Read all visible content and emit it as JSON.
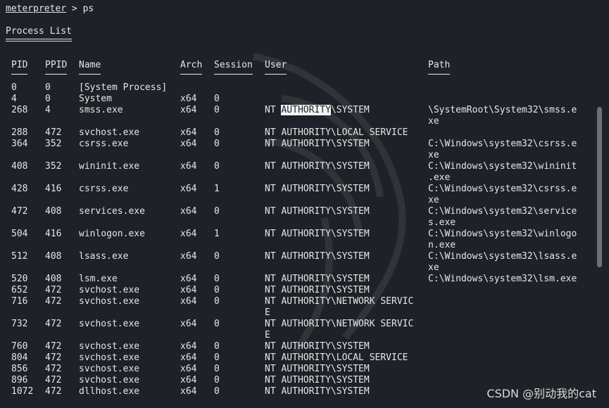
{
  "prompt": {
    "name": "meterpreter",
    "separator": " > ",
    "command": "ps"
  },
  "title": "Process List",
  "headers": [
    "PID",
    "PPID",
    "Name",
    "Arch",
    "Session",
    "User",
    "Path"
  ],
  "rows": [
    {
      "pid": "0",
      "ppid": "0",
      "name": "[System Process]",
      "arch": "",
      "session": "",
      "user": "",
      "path": ""
    },
    {
      "pid": "4",
      "ppid": "0",
      "name": "System",
      "arch": "x64",
      "session": "0",
      "user": "",
      "path": ""
    },
    {
      "pid": "268",
      "ppid": "4",
      "name": "smss.exe",
      "arch": "x64",
      "session": "0",
      "user": "NT AUTHORITY\\SYSTEM",
      "path": "\\SystemRoot\\System32\\smss.exe"
    },
    {
      "pid": "288",
      "ppid": "472",
      "name": "svchost.exe",
      "arch": "x64",
      "session": "0",
      "user": "NT AUTHORITY\\LOCAL SERVICE",
      "path": ""
    },
    {
      "pid": "364",
      "ppid": "352",
      "name": "csrss.exe",
      "arch": "x64",
      "session": "0",
      "user": "NT AUTHORITY\\SYSTEM",
      "path": "C:\\Windows\\system32\\csrss.exe"
    },
    {
      "pid": "408",
      "ppid": "352",
      "name": "wininit.exe",
      "arch": "x64",
      "session": "0",
      "user": "NT AUTHORITY\\SYSTEM",
      "path": "C:\\Windows\\system32\\wininit.exe"
    },
    {
      "pid": "428",
      "ppid": "416",
      "name": "csrss.exe",
      "arch": "x64",
      "session": "1",
      "user": "NT AUTHORITY\\SYSTEM",
      "path": "C:\\Windows\\system32\\csrss.exe"
    },
    {
      "pid": "472",
      "ppid": "408",
      "name": "services.exe",
      "arch": "x64",
      "session": "0",
      "user": "NT AUTHORITY\\SYSTEM",
      "path": "C:\\Windows\\system32\\services.exe"
    },
    {
      "pid": "504",
      "ppid": "416",
      "name": "winlogon.exe",
      "arch": "x64",
      "session": "1",
      "user": "NT AUTHORITY\\SYSTEM",
      "path": "C:\\Windows\\system32\\winlogon.exe"
    },
    {
      "pid": "512",
      "ppid": "408",
      "name": "lsass.exe",
      "arch": "x64",
      "session": "0",
      "user": "NT AUTHORITY\\SYSTEM",
      "path": "C:\\Windows\\system32\\lsass.exe"
    },
    {
      "pid": "520",
      "ppid": "408",
      "name": "lsm.exe",
      "arch": "x64",
      "session": "0",
      "user": "NT AUTHORITY\\SYSTEM",
      "path": "C:\\Windows\\system32\\lsm.exe"
    },
    {
      "pid": "652",
      "ppid": "472",
      "name": "svchost.exe",
      "arch": "x64",
      "session": "0",
      "user": "NT AUTHORITY\\SYSTEM",
      "path": ""
    },
    {
      "pid": "716",
      "ppid": "472",
      "name": "svchost.exe",
      "arch": "x64",
      "session": "0",
      "user": "NT AUTHORITY\\NETWORK SERVICE",
      "path": ""
    },
    {
      "pid": "732",
      "ppid": "472",
      "name": "svchost.exe",
      "arch": "x64",
      "session": "0",
      "user": "NT AUTHORITY\\NETWORK SERVICE",
      "path": ""
    },
    {
      "pid": "760",
      "ppid": "472",
      "name": "svchost.exe",
      "arch": "x64",
      "session": "0",
      "user": "NT AUTHORITY\\SYSTEM",
      "path": ""
    },
    {
      "pid": "804",
      "ppid": "472",
      "name": "svchost.exe",
      "arch": "x64",
      "session": "0",
      "user": "NT AUTHORITY\\LOCAL SERVICE",
      "path": ""
    },
    {
      "pid": "856",
      "ppid": "472",
      "name": "svchost.exe",
      "arch": "x64",
      "session": "0",
      "user": "NT AUTHORITY\\SYSTEM",
      "path": ""
    },
    {
      "pid": "896",
      "ppid": "472",
      "name": "svchost.exe",
      "arch": "x64",
      "session": "0",
      "user": "NT AUTHORITY\\SYSTEM",
      "path": ""
    },
    {
      "pid": "1072",
      "ppid": "472",
      "name": "dllhost.exe",
      "arch": "x64",
      "session": "0",
      "user": "NT AUTHORITY\\SYSTEM",
      "path": ""
    }
  ],
  "highlight": {
    "text": "AUTHORITY"
  },
  "watermark": "CSDN @别动我的cat"
}
